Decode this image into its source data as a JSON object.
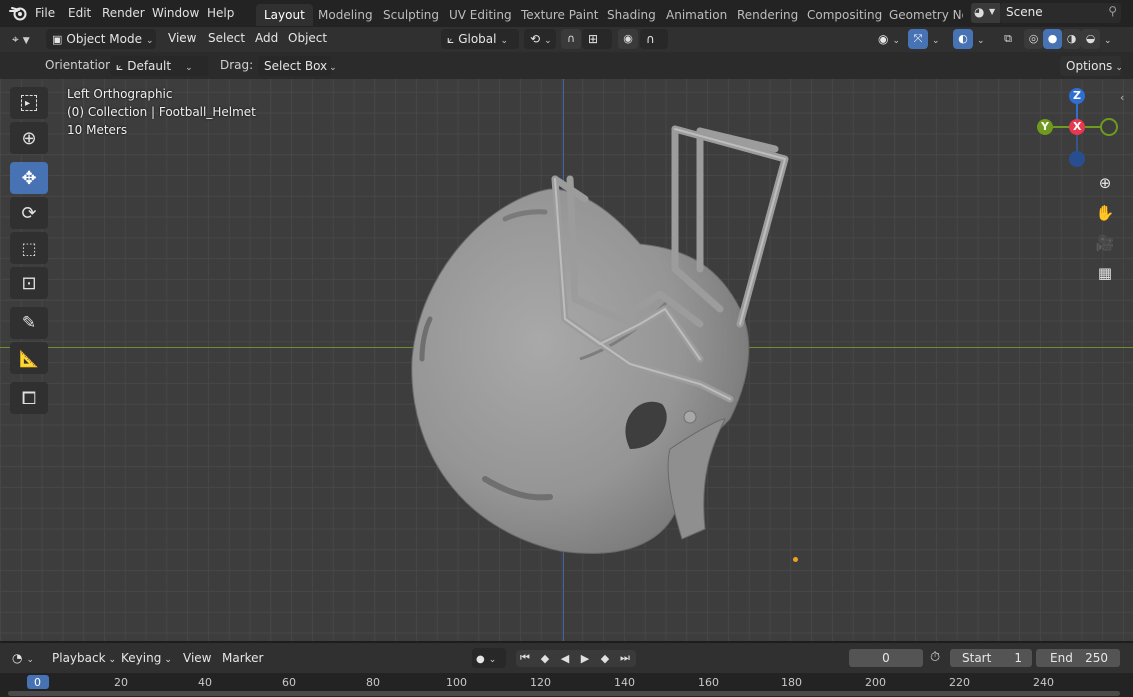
{
  "topbar": {
    "menus": [
      "File",
      "Edit",
      "Render",
      "Window",
      "Help"
    ],
    "workspaces": [
      "Layout",
      "Modeling",
      "Sculpting",
      "UV Editing",
      "Texture Paint",
      "Shading",
      "Animation",
      "Rendering",
      "Compositing",
      "Geometry Noc"
    ],
    "active_workspace": "Layout",
    "scene": "Scene"
  },
  "viewport_header": {
    "mode": "Object Mode",
    "menus": [
      "View",
      "Select",
      "Add",
      "Object"
    ],
    "transform_orientation": "Global"
  },
  "tool_header": {
    "orientation_label": "Orientation:",
    "orientation_value": "Default",
    "drag_label": "Drag:",
    "drag_value": "Select Box",
    "options": "Options"
  },
  "viewport": {
    "view_name": "Left Orthographic",
    "collection": "(0) Collection | Football_Helmet",
    "scale": "10 Meters",
    "gizmo_axes": {
      "z": "Z",
      "y": "Y",
      "x": "X"
    },
    "colors": {
      "x_axis": "#e8384f",
      "y_axis": "#6e9a1d",
      "z_axis": "#2f6fd1",
      "grid_x_line": "#6e8d2f",
      "grid_y_line": "#3f64a6",
      "active_tool": "#4772b3"
    }
  },
  "tools_left": [
    "select-box-icon",
    "cursor-icon",
    "move-icon",
    "rotate-icon",
    "scale-icon",
    "transform-icon",
    "annotate-icon",
    "measure-icon",
    "add-cube-icon"
  ],
  "timeline": {
    "menus": [
      "Playback",
      "Keying",
      "View",
      "Marker"
    ],
    "current_frame": "0",
    "start_label": "Start",
    "start_value": "1",
    "end_label": "End",
    "end_value": "250",
    "ruler": [
      "0",
      "20",
      "40",
      "60",
      "80",
      "100",
      "120",
      "140",
      "160",
      "180",
      "200",
      "220",
      "240"
    ]
  }
}
